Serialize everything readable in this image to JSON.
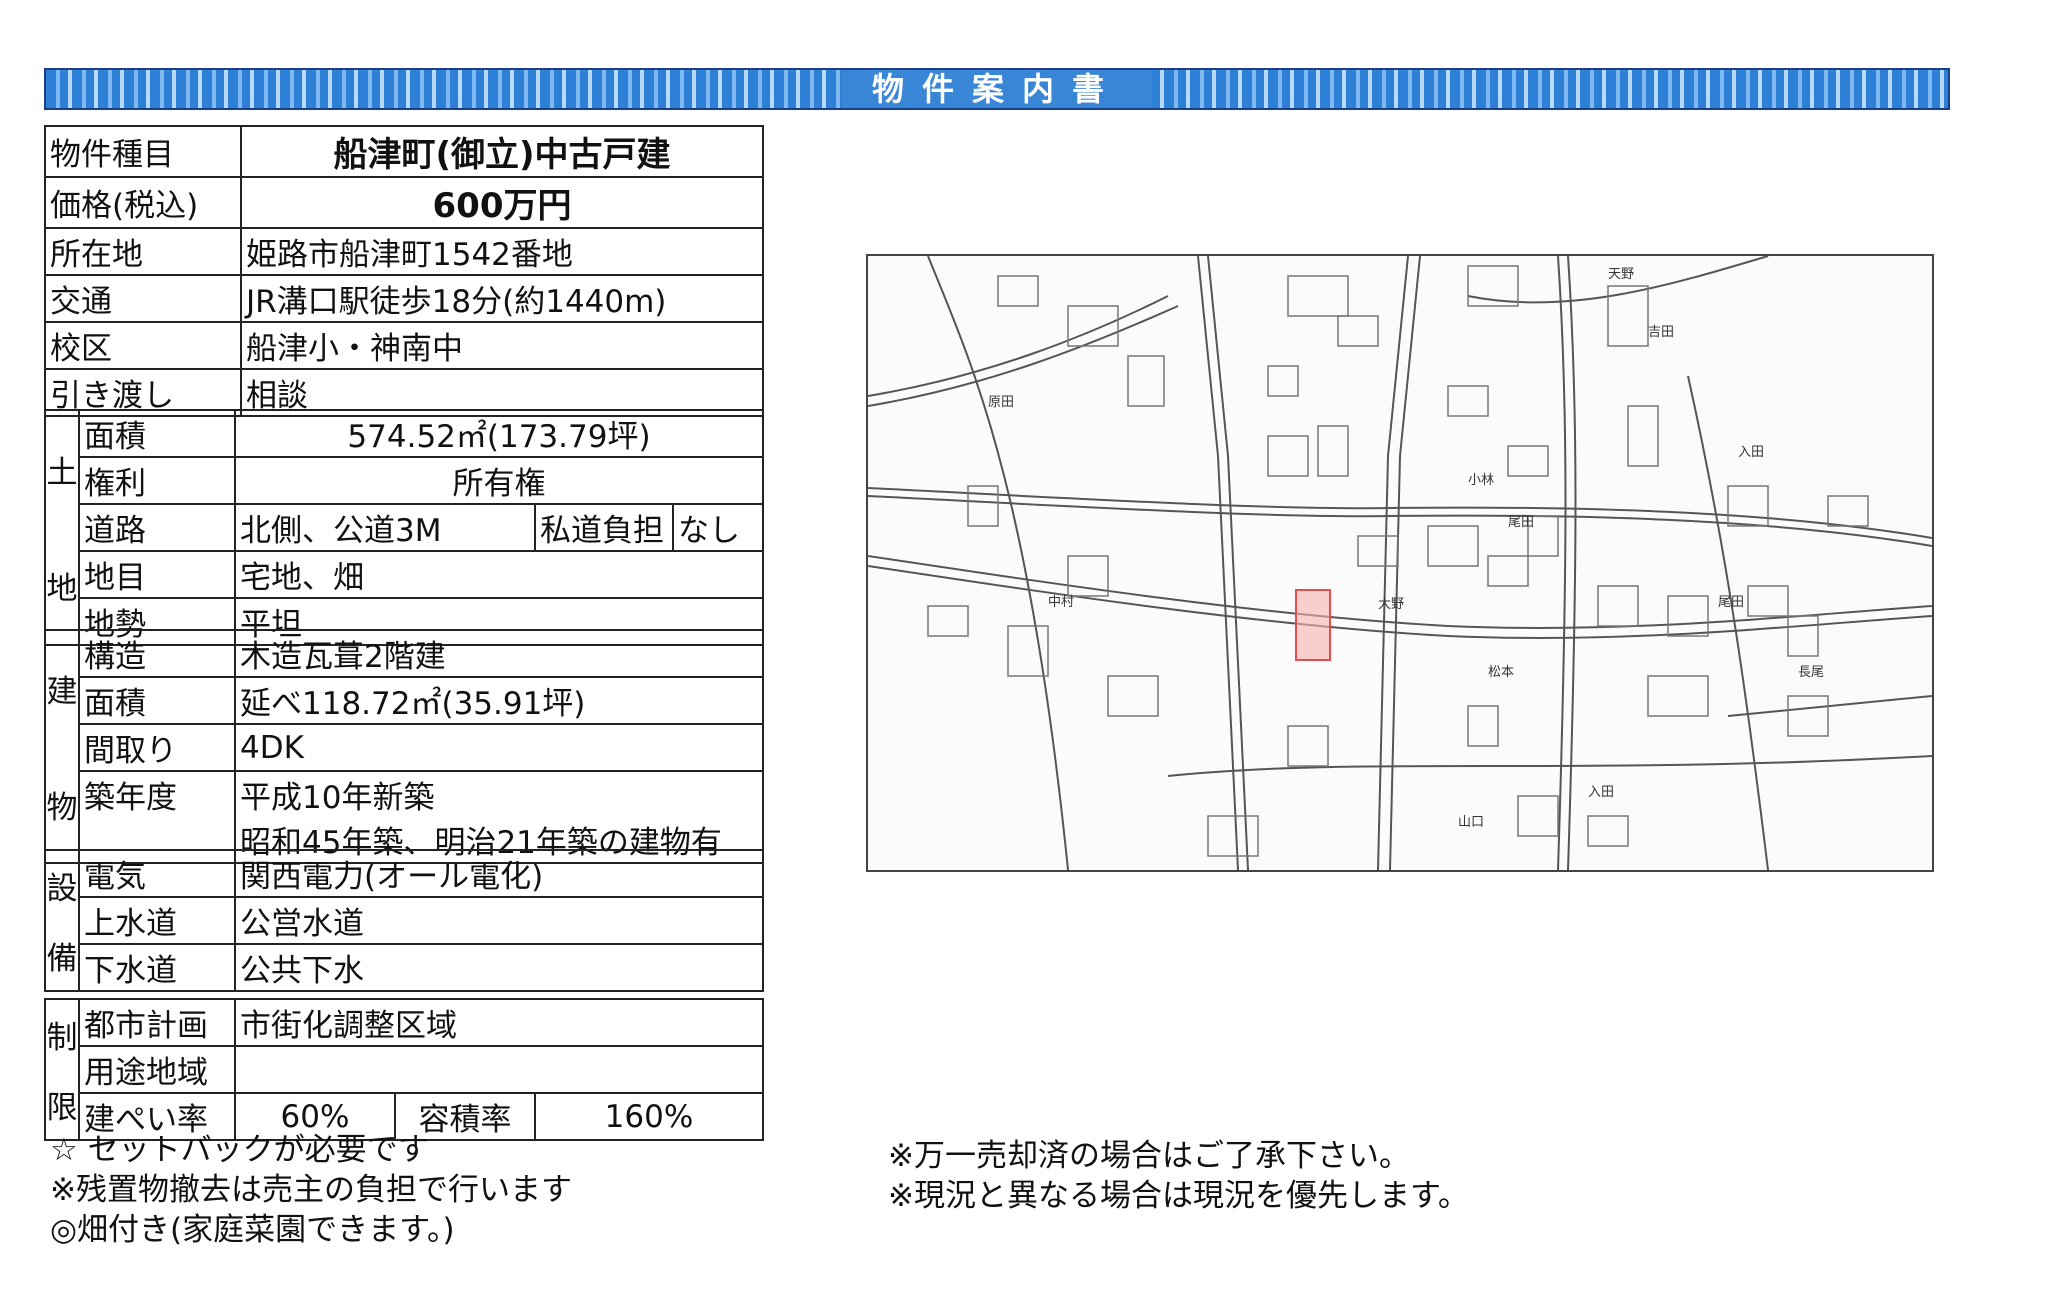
{
  "banner": {
    "title": "物件案内書"
  },
  "basic": {
    "rows": [
      {
        "label": "物件種目",
        "value": "船津町(御立)中古戸建"
      },
      {
        "label": "価格(税込)",
        "value": "600万円"
      },
      {
        "label": "所在地",
        "value": "姫路市船津町1542番地"
      },
      {
        "label": "交通",
        "value": "JR溝口駅徒歩18分(約1440m)"
      },
      {
        "label": "校区",
        "value": "船津小・神南中"
      },
      {
        "label": "引き渡し",
        "value": "相談"
      }
    ]
  },
  "land": {
    "group1": "土",
    "group2": "地",
    "area_label": "面積",
    "area_value": "574.52㎡(173.79坪)",
    "rights_label": "権利",
    "rights_value": "所有権",
    "road_label": "道路",
    "road_value": "北側、公道3M",
    "private_road_label": "私道負担",
    "private_road_value": "なし",
    "category_label": "地目",
    "category_value": "宅地、畑",
    "terrain_label": "地勢",
    "terrain_value": "平坦"
  },
  "building": {
    "group1": "建",
    "group2": "物",
    "structure_label": "構造",
    "structure_value": "木造瓦葺2階建",
    "area_label": "面積",
    "area_value": "延べ118.72㎡(35.91坪)",
    "layout_label": "間取り",
    "layout_value": "4DK",
    "built_label": "築年度",
    "built_value1": "平成10年新築",
    "built_value2": "昭和45年築、明治21年築の建物有"
  },
  "facilities": {
    "group1": "設",
    "group2": "備",
    "electric_label": "電気",
    "electric_value": "関西電力(オール電化)",
    "water_label": "上水道",
    "water_value": "公営水道",
    "sewer_label": "下水道",
    "sewer_value": "公共下水"
  },
  "restrictions": {
    "group1": "制",
    "group2": "限",
    "city_plan_label": "都市計画",
    "city_plan_value": "市街化調整区域",
    "zoning_label": "用途地域",
    "zoning_value": "",
    "bcr_label": "建ぺい率",
    "bcr_value": "60%",
    "far_label": "容積率",
    "far_value": "160%"
  },
  "notes_left": [
    "☆ セットバックが必要です",
    "※残置物撤去は売主の負担で行います",
    "◎畑付き(家庭菜園できます。)"
  ],
  "notes_right": [
    "※万一売却済の場合はご了承下さい。",
    "※現況と異なる場合は現況を優先します。"
  ],
  "map": {
    "labels": [
      "天野",
      "吉田",
      "入田",
      "尾田",
      "大野",
      "中村",
      "山口",
      "長尾",
      "松本",
      "原田",
      "尾田",
      "小林",
      "入田"
    ]
  }
}
